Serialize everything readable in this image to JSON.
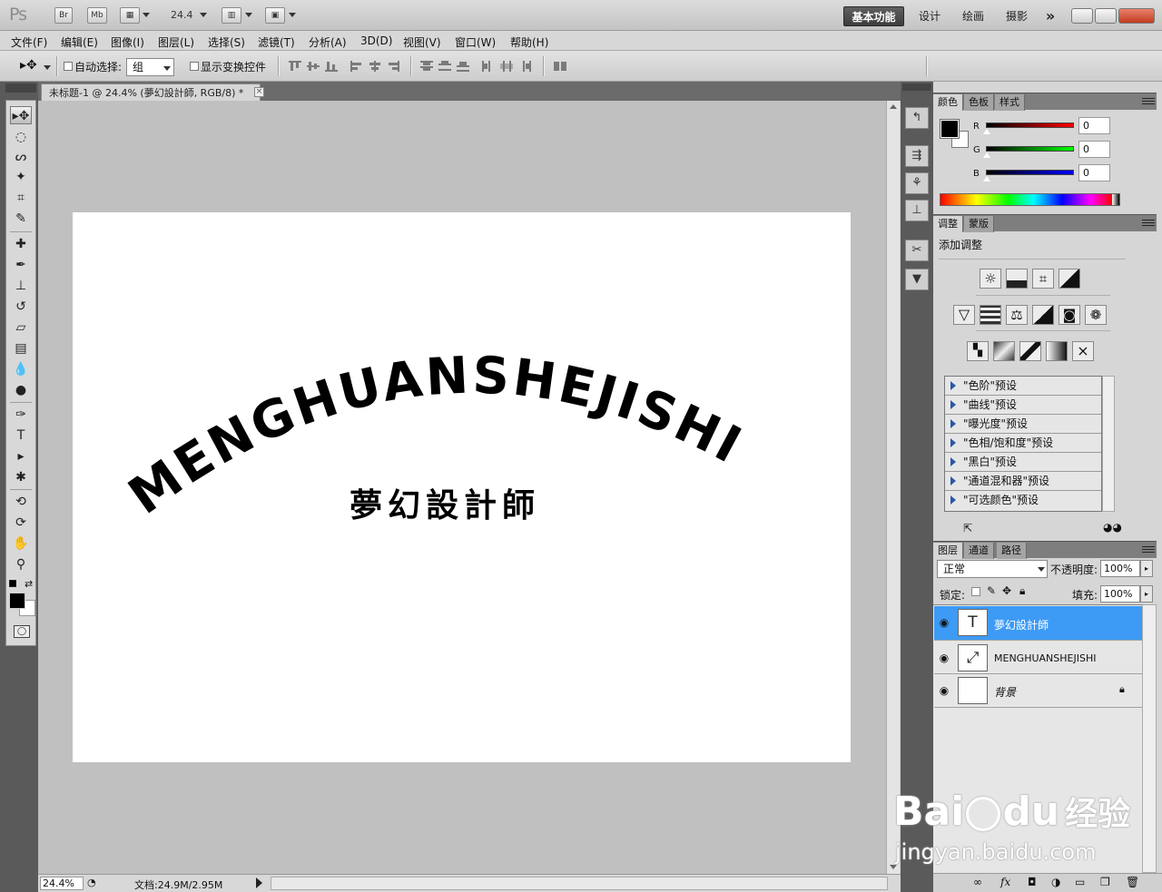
{
  "app": {
    "logo": "Ps",
    "bridge_label": "Br",
    "mini_bridge_label": "Mb",
    "zoom_value": "24.4",
    "workspaces": [
      "基本功能",
      "设计",
      "绘画",
      "摄影"
    ],
    "more_label": "»"
  },
  "menu": [
    "文件(F)",
    "编辑(E)",
    "图像(I)",
    "图层(L)",
    "选择(S)",
    "滤镜(T)",
    "分析(A)",
    "3D(D)",
    "视图(V)",
    "窗口(W)",
    "帮助(H)"
  ],
  "options": {
    "auto_select_label": "自动选择:",
    "auto_select_value": "组",
    "show_transform_label": "显示变换控件"
  },
  "document": {
    "tab_title": "未标题-1 @ 24.4% (夢幻設計師, RGB/8) *",
    "close_glyph": "×",
    "arched_text": "MENGHUANSHEJISHI",
    "chinese_text": "夢幻設計師"
  },
  "status": {
    "zoom": "24.4%",
    "doc_info": "文档:24.9M/2.95M"
  },
  "color_panel": {
    "tabs": [
      "颜色",
      "色板",
      "样式"
    ],
    "channels": [
      {
        "label": "R",
        "value": "0",
        "color": "#d40000"
      },
      {
        "label": "G",
        "value": "0",
        "color": "#00b400"
      },
      {
        "label": "B",
        "value": "0",
        "color": "#0000d4"
      }
    ]
  },
  "adjust_panel": {
    "tabs": [
      "调整",
      "蒙版"
    ],
    "title": "添加调整",
    "presets": [
      "\"色阶\"预设",
      "\"曲线\"预设",
      "\"曝光度\"预设",
      "\"色相/饱和度\"预设",
      "\"黑白\"预设",
      "\"通道混和器\"预设",
      "\"可选颜色\"预设"
    ]
  },
  "layers_panel": {
    "tabs": [
      "图层",
      "通道",
      "路径"
    ],
    "blend_mode": "正常",
    "opacity_label": "不透明度:",
    "opacity_value": "100%",
    "lock_label": "锁定:",
    "fill_label": "填充:",
    "fill_value": "100%",
    "layers": [
      {
        "name": "夢幻設計師",
        "thumb": "T",
        "selected": true
      },
      {
        "name": "MENGHUANSHEJISHI",
        "thumb": "⤢",
        "selected": false
      },
      {
        "name": "背景",
        "thumb": "",
        "selected": false,
        "locked": true
      }
    ],
    "footer_icons": [
      "link-icon",
      "fx-icon",
      "mask-icon",
      "adjustment-icon",
      "group-icon",
      "new-layer-icon",
      "trash-icon"
    ]
  },
  "watermark": {
    "brand": "Bai",
    "brand2": "du",
    "suffix": "经验",
    "url": "jingyan.baidu.com"
  }
}
